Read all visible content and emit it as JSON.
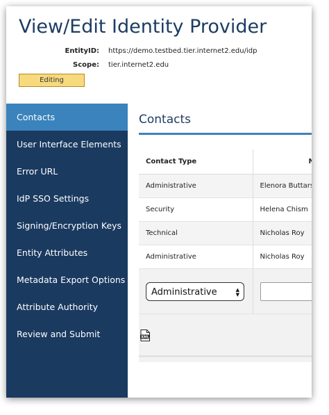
{
  "page": {
    "title": "View/Edit Identity Provider",
    "entity_label": "EntityID:",
    "entity_value": "https://demo.testbed.tier.internet2.edu/idp",
    "scope_label": "Scope:",
    "scope_value": "tier.internet2.edu",
    "status_badge": "Editing"
  },
  "sidebar": {
    "items": [
      {
        "label": "Contacts",
        "active": true
      },
      {
        "label": "User Interface Elements"
      },
      {
        "label": "Error URL"
      },
      {
        "label": "IdP SSO Settings"
      },
      {
        "label": "Signing/Encryption Keys"
      },
      {
        "label": "Entity Attributes"
      },
      {
        "label": "Metadata Export Options"
      },
      {
        "label": "Attribute Authority"
      },
      {
        "label": "Review and Submit"
      }
    ]
  },
  "main": {
    "section_title": "Contacts",
    "table": {
      "headers": [
        "Contact Type",
        "N"
      ],
      "rows": [
        [
          "Administrative",
          "Elenora Buttars"
        ],
        [
          "Security",
          "Helena Chism"
        ],
        [
          "Technical",
          "Nicholas Roy"
        ],
        [
          "Administrative",
          "Nicholas Roy"
        ]
      ],
      "new_contact_type": "Administrative"
    },
    "export_icon": "xml-file-icon"
  },
  "colors": {
    "sidebar_bg": "#1a3a60",
    "sidebar_active": "#3a83bc",
    "title_text": "#1c3c62",
    "badge_bg": "#f6da7d"
  }
}
